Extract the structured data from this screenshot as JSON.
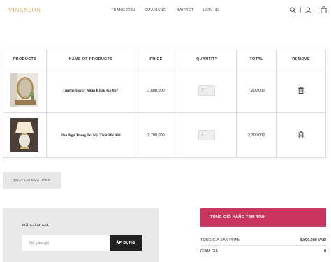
{
  "brand": {
    "logo": "VINANEON",
    "accent": "#c9a54a"
  },
  "nav": {
    "items": [
      "TRANG CHỦ",
      "CỬA HÀNG",
      "BÀI VIẾT",
      "LIÊN HỆ"
    ]
  },
  "header_icons": [
    "search-icon",
    "user-icon",
    "cart-icon"
  ],
  "cart": {
    "headers": [
      "PRODUCTS",
      "NAME OF PRODUCTS",
      "PRICE",
      "QUANTITY",
      "TOTAL",
      "REMOVE"
    ],
    "rows": [
      {
        "image": "mirror",
        "name": "Gương Decor Nhập Khẩu GS 067",
        "price": "3,600,000",
        "quantity": "2",
        "total": "7,200,000",
        "remove_icon": "trash-icon"
      },
      {
        "image": "lamp",
        "name": "Đèn Ngủ Trang Trí Nội Thất DN 098",
        "price": "2,700,000",
        "quantity": "1",
        "total": "2,700,000",
        "remove_icon": "trash-icon"
      }
    ]
  },
  "continue_button": "QUAY LẠI MUA HÀNG",
  "coupon": {
    "label": "MÃ GIẢM GIÁ",
    "placeholder": "Mã giảm giá",
    "apply_label": "ÁP DỤNG"
  },
  "totals": {
    "heading": "TỔNG GIỎ HÀNG TẠM TÍNH",
    "heading_color": "#c9355f",
    "subtotal_label": "TỔNG GIÁ SẢN PHẨM",
    "subtotal_value": "9,900,000 VNĐ",
    "discount_label": "GIẢM GIÁ",
    "discount_value": "0"
  }
}
